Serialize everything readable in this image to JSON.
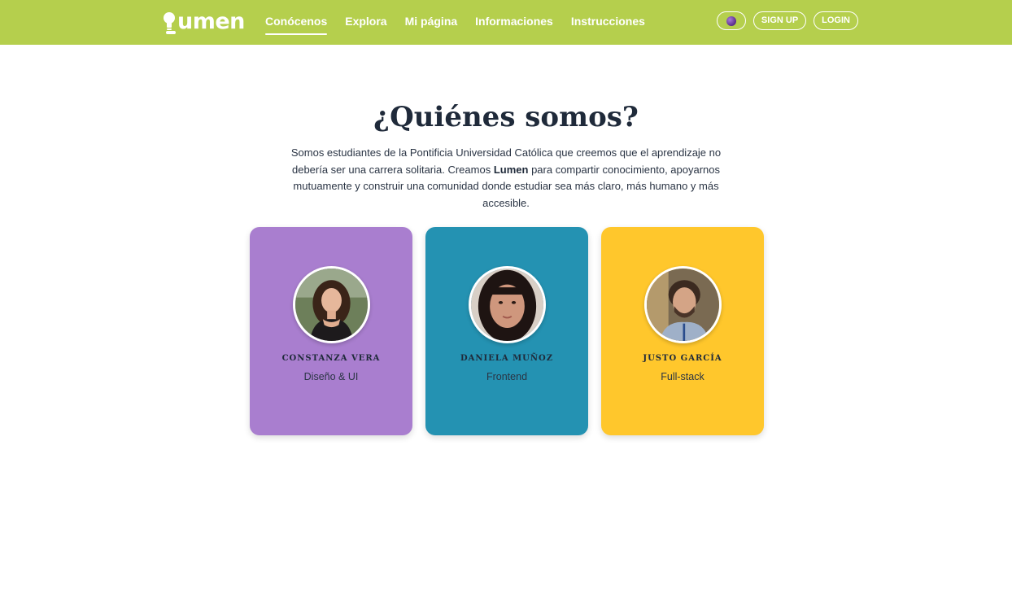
{
  "brand": {
    "name": "umen",
    "logo_icon": "lightbulb-icon",
    "colors": {
      "navbar": "#b5cf4d",
      "text": "#1f2a3a"
    }
  },
  "nav": {
    "links": [
      "Conócenos",
      "Explora",
      "Mi página",
      "Informaciones",
      "Instrucciones"
    ],
    "active": "Conócenos",
    "theme_icon": "theme-toggle-icon",
    "signup_label": "SIGN UP",
    "login_label": "LOGIN"
  },
  "about": {
    "title": "¿Quiénes somos?",
    "intro_before": "Somos estudiantes de la Pontificia Universidad Católica que creemos que el aprendizaje no debería ser una carrera solitaria. Creamos ",
    "intro_brand": "Lumen",
    "intro_after": " para compartir conocimiento, apoyarnos mutuamente y construir una comunidad donde estudiar sea más claro, más humano y más accesible."
  },
  "team": [
    {
      "name": "CONSTANZA VERA",
      "role": "Diseño & UI",
      "color": "#a97ecf"
    },
    {
      "name": "DANIELA MUÑOZ",
      "role": "Frontend",
      "color": "#2492b2"
    },
    {
      "name": "JUSTO GARCÍA",
      "role": "Full-stack",
      "color": "#ffc72c"
    }
  ]
}
